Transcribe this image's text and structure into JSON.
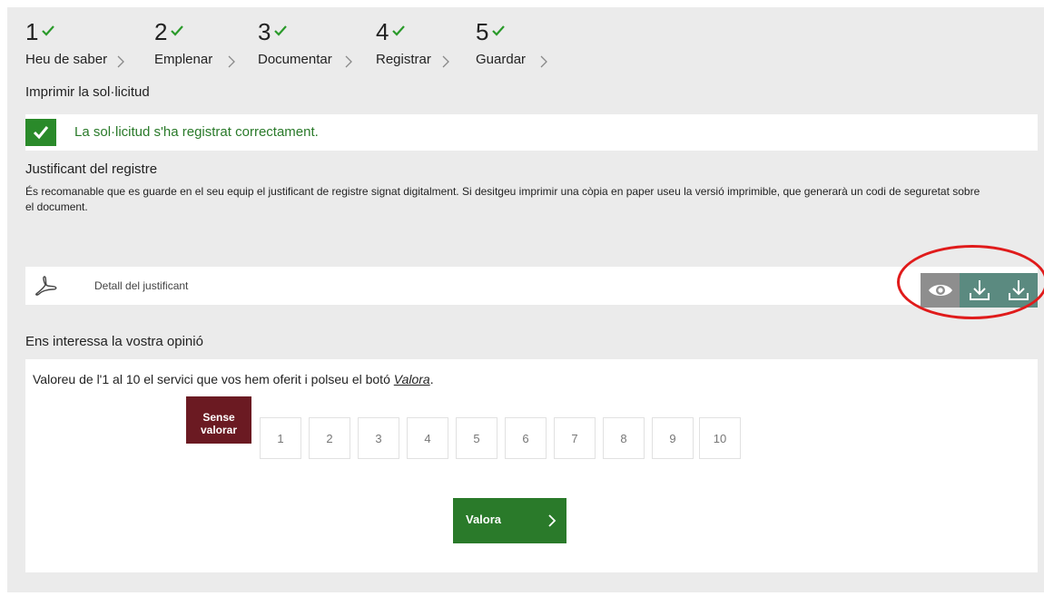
{
  "steps": [
    {
      "number": "1",
      "label": "Heu de saber"
    },
    {
      "number": "2",
      "label": "Emplenar"
    },
    {
      "number": "3",
      "label": "Documentar"
    },
    {
      "number": "4",
      "label": "Registrar"
    },
    {
      "number": "5",
      "label": "Guardar"
    }
  ],
  "page_title": "Imprimir la sol·licitud",
  "success_message": "La sol·licitud s'ha registrat correctament.",
  "receipt": {
    "title": "Justificant del registre",
    "description": "És recomanable que es guarde en el seu equip el justificant de registre signat digitalment. Si desitgeu imprimir una còpia en paper useu la versió imprimible, que generarà un codi de seguretat sobre el document.",
    "document_label": "Detall del justificant",
    "actions": [
      "eye-icon",
      "download-icon",
      "download-icon"
    ]
  },
  "opinion": {
    "title": "Ens interessa la vostra opinió",
    "instruction_prefix": "Valoreu de l'1 al 10 el servici que vos hem oferit i polseu el botó ",
    "instruction_link": "Valora",
    "instruction_suffix": ".",
    "unrated_label": "Sense valorar",
    "scores": [
      "1",
      "2",
      "3",
      "4",
      "5",
      "6",
      "7",
      "8",
      "9",
      "10"
    ],
    "submit_label": "Valora"
  },
  "colors": {
    "success_green": "#2a8a2a",
    "unrated_bg": "#6b1a22",
    "action_teal": "#5b8a80",
    "highlight_red": "#e01b1b"
  }
}
